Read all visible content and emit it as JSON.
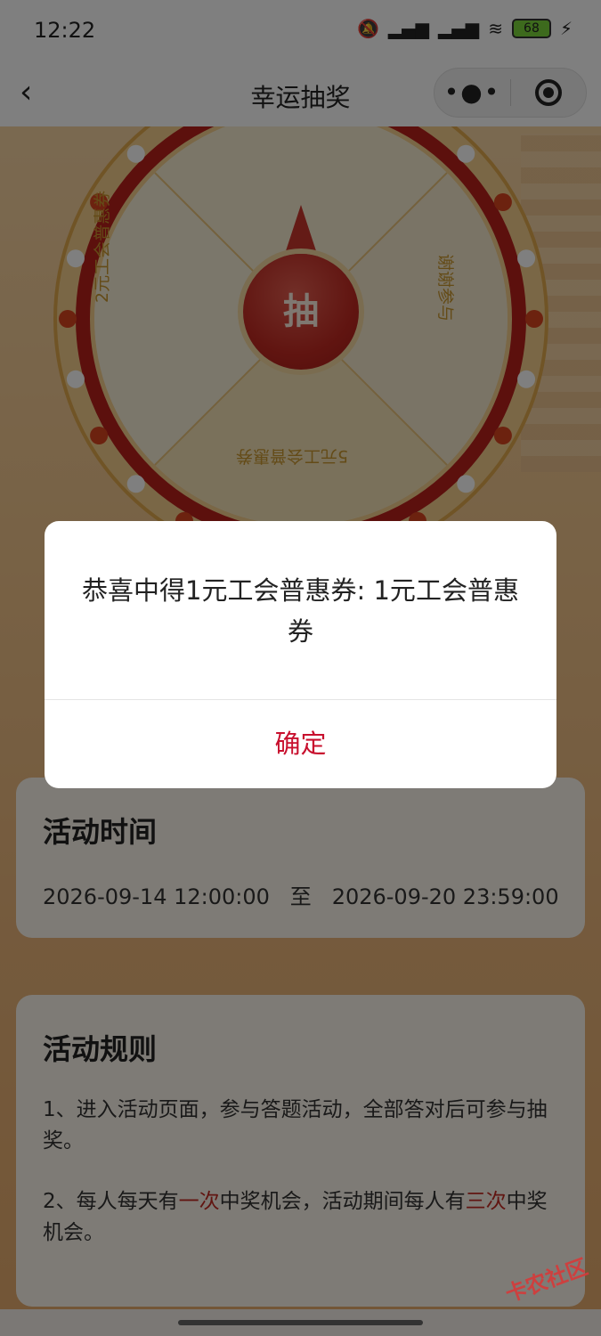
{
  "status_bar": {
    "time": "12:22",
    "battery": "68"
  },
  "nav": {
    "title": "幸运抽奖"
  },
  "wheel": {
    "prizes": [
      "2元工会普惠券",
      "谢谢参与",
      "5元工会普惠券"
    ],
    "spin_label": "抽"
  },
  "activity_time": {
    "title": "活动时间",
    "start": "2026-09-14 12:00:00",
    "separator": "至",
    "end": "2026-09-20 23:59:00"
  },
  "rules": {
    "title": "活动规则",
    "rule1": "1、进入活动页面，参与答题活动，全部答对后可参与抽奖。",
    "rule2_a": "2、每人每天有",
    "rule2_b": "一次",
    "rule2_c": "中奖机会，活动期间每人有",
    "rule2_d": "三次",
    "rule2_e": "中奖机会。"
  },
  "dialog": {
    "message": "恭喜中得1元工会普惠券: 1元工会普惠券",
    "confirm": "确定"
  },
  "watermark": "卡农社区",
  "colors": {
    "accent": "#c8102e",
    "wheel_red": "#c22a22",
    "highlight": "#c22a22"
  }
}
